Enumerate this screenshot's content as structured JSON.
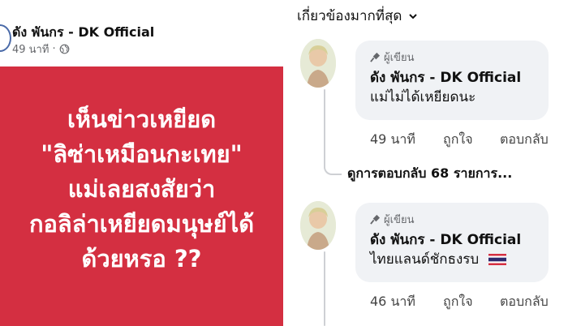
{
  "post": {
    "author": "ดัง พันกร - DK Official",
    "time": "49 นาที",
    "privacy_icon": "globe-icon",
    "card_color": "#d42f41",
    "headline_lines": [
      "เห็นข่าวเหยียด",
      "\"ลิซ่าเหมือนกะเทย\"",
      "แม่เลยสงสัยว่า",
      "กอลิล่าเหยียดมนุษย์ได้",
      "ด้วยหรอ ??"
    ]
  },
  "comments_panel": {
    "sort_label": "เกี่ยวข้องมากที่สุด",
    "comments": [
      {
        "badge": "ผู้เขียน",
        "author": "ดัง พันกร - DK Official",
        "text": "แม่ไม่ได้เหยียดนะ",
        "time": "49 นาที",
        "like": "ถูกใจ",
        "reply": "ตอบกลับ",
        "replies_label": "ดูการตอบกลับ 68 รายการ..."
      },
      {
        "badge": "ผู้เขียน",
        "author": "ดัง พันกร - DK Official",
        "text": "ไทยแลนด์ชักธงรบ",
        "flag_icon": "thai-flag-icon",
        "time": "46 นาที",
        "like": "ถูกใจ",
        "reply": "ตอบกลับ"
      }
    ]
  }
}
